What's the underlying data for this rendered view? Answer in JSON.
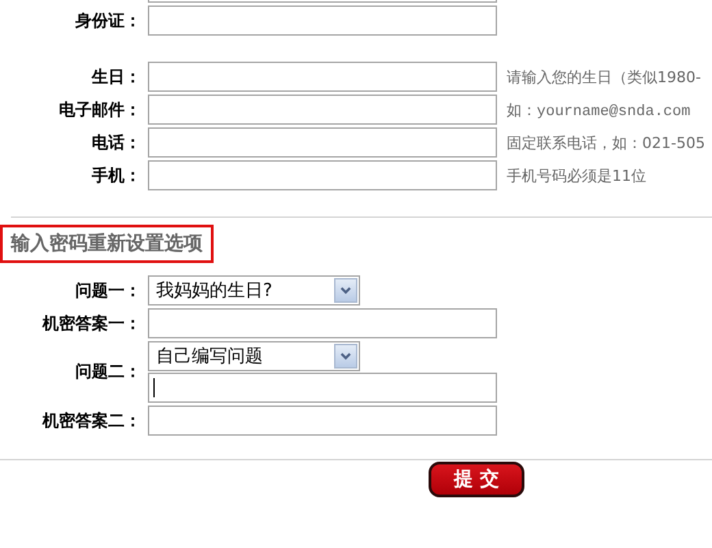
{
  "profile_groups": [
    {
      "fields": [
        {
          "kind": "clipped"
        },
        {
          "kind": "text",
          "label": "身份证："
        }
      ]
    },
    {
      "fields": [
        {
          "kind": "text",
          "label": "生日：",
          "hint": "请输入您的生日（类似1980-"
        },
        {
          "kind": "email",
          "label": "电子邮件：",
          "hint": "如：yourname@snda.com"
        },
        {
          "kind": "text",
          "label": "电话：",
          "hint": "固定联系电话，如：021-505"
        },
        {
          "kind": "text",
          "label": "手机：",
          "hint": "手机号码必须是11位"
        }
      ]
    }
  ],
  "section_title": "输入密码重新设置选项",
  "security_fields": [
    {
      "kind": "select",
      "label": "问题一：",
      "value": "我妈妈的生日?"
    },
    {
      "kind": "text",
      "label": "机密答案一："
    },
    {
      "kind": "select_custom",
      "label": "问题二：",
      "value": "自己编写问题",
      "focused": true
    },
    {
      "kind": "text",
      "label": "机密答案二："
    }
  ],
  "submit_button": "提 交"
}
